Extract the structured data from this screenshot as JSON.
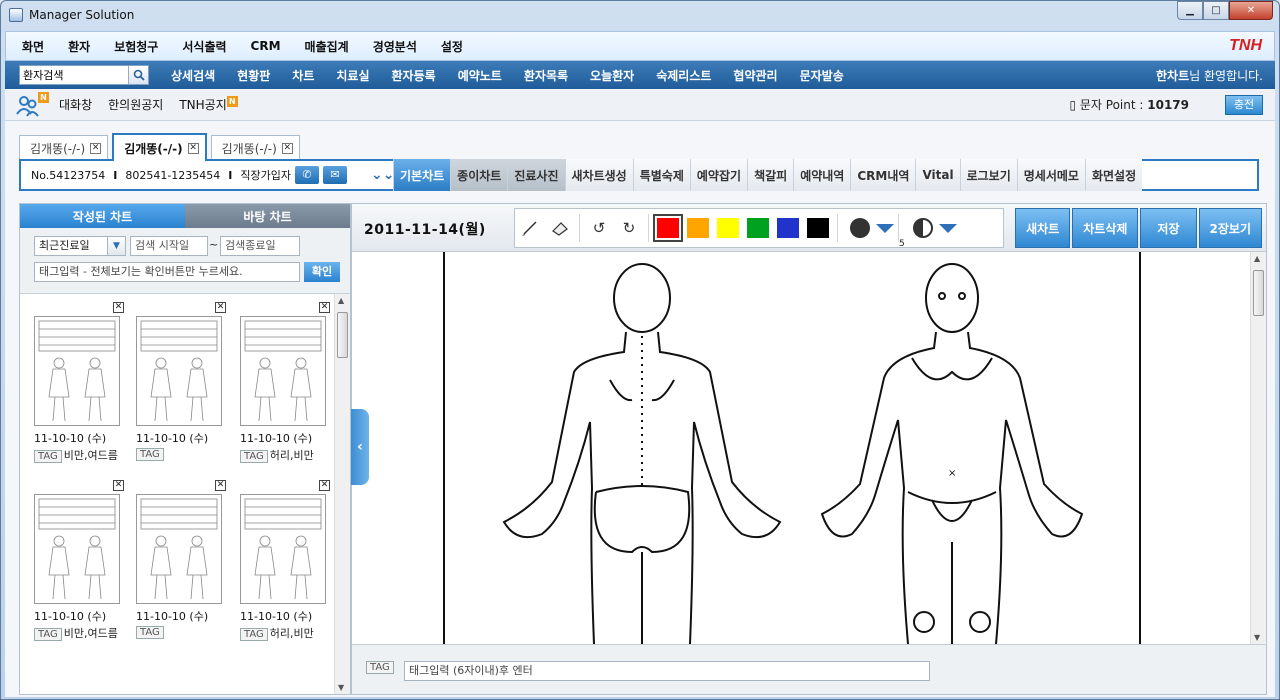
{
  "window": {
    "title": "Manager Solution",
    "min": "▁",
    "max": "□",
    "close": "✕"
  },
  "menu": {
    "items": [
      "화면",
      "환자",
      "보험청구",
      "서식출력",
      "CRM",
      "매출집계",
      "경영분석",
      "설정"
    ],
    "brand": "TNH"
  },
  "nav": {
    "search_value": "환자검색",
    "items": [
      "상세검색",
      "현황판",
      "차트",
      "치료실",
      "환자등록",
      "예약노트",
      "환자목록",
      "오늘환자",
      "숙제리스트",
      "협약관리",
      "문자발송"
    ],
    "welcome_name": "한차트",
    "welcome_suffix": "님 환영합니다."
  },
  "sub": {
    "badge": "N",
    "items": [
      "대화창",
      "한의원공지",
      "TNH공지"
    ],
    "sms_label": "문자 Point : ",
    "sms_value": "10179",
    "charge": "충전"
  },
  "patient_tabs": [
    "김개똥(-/-)",
    "김개똥(-/-)",
    "김개똥(-/-)"
  ],
  "patient_info": {
    "no": "No.54123754",
    "ssn": "802541-1235454",
    "type": "직장가입자",
    "sep": "I"
  },
  "chart_tabs": [
    "기본차트",
    "종이차트",
    "진료사진",
    "새차트생성",
    "특별숙제",
    "예약잡기",
    "책갈피",
    "예약내역",
    "CRM내역",
    "Vital",
    "로그보기",
    "명세서메모",
    "화면설정"
  ],
  "left": {
    "tab_active": "작성된 차트",
    "tab_other": "바탕 차트",
    "select": "최근진료일",
    "start_placeholder": "검색 시작일",
    "tilde": "~",
    "end_placeholder": "검색종료일",
    "tag_placeholder": "태그입력 - 전체보기는 확인버튼만 누르세요.",
    "confirm": "확인",
    "thumbs": [
      {
        "date": "11-10-10 (수)",
        "tag": "TAG",
        "text": "비만,여드름"
      },
      {
        "date": "11-10-10 (수)",
        "tag": "TAG",
        "text": ""
      },
      {
        "date": "11-10-10 (수)",
        "tag": "TAG",
        "text": "허리,비만"
      },
      {
        "date": "11-10-10 (수)",
        "tag": "TAG",
        "text": "비만,여드름"
      },
      {
        "date": "11-10-10 (수)",
        "tag": "TAG",
        "text": ""
      },
      {
        "date": "11-10-10 (수)",
        "tag": "TAG",
        "text": "허리,비만"
      }
    ]
  },
  "chart": {
    "date": "2011-11-14(월)",
    "colors": [
      "#ff0000",
      "#ffa500",
      "#ffff00",
      "#00a020",
      "#2233cc",
      "#000000"
    ],
    "brush_size": "5",
    "buttons": [
      "새차트",
      "차트삭제",
      "저장",
      "2장보기"
    ],
    "tag_label": "TAG",
    "tag_input": "태그입력 (6자이내)후 엔터"
  }
}
